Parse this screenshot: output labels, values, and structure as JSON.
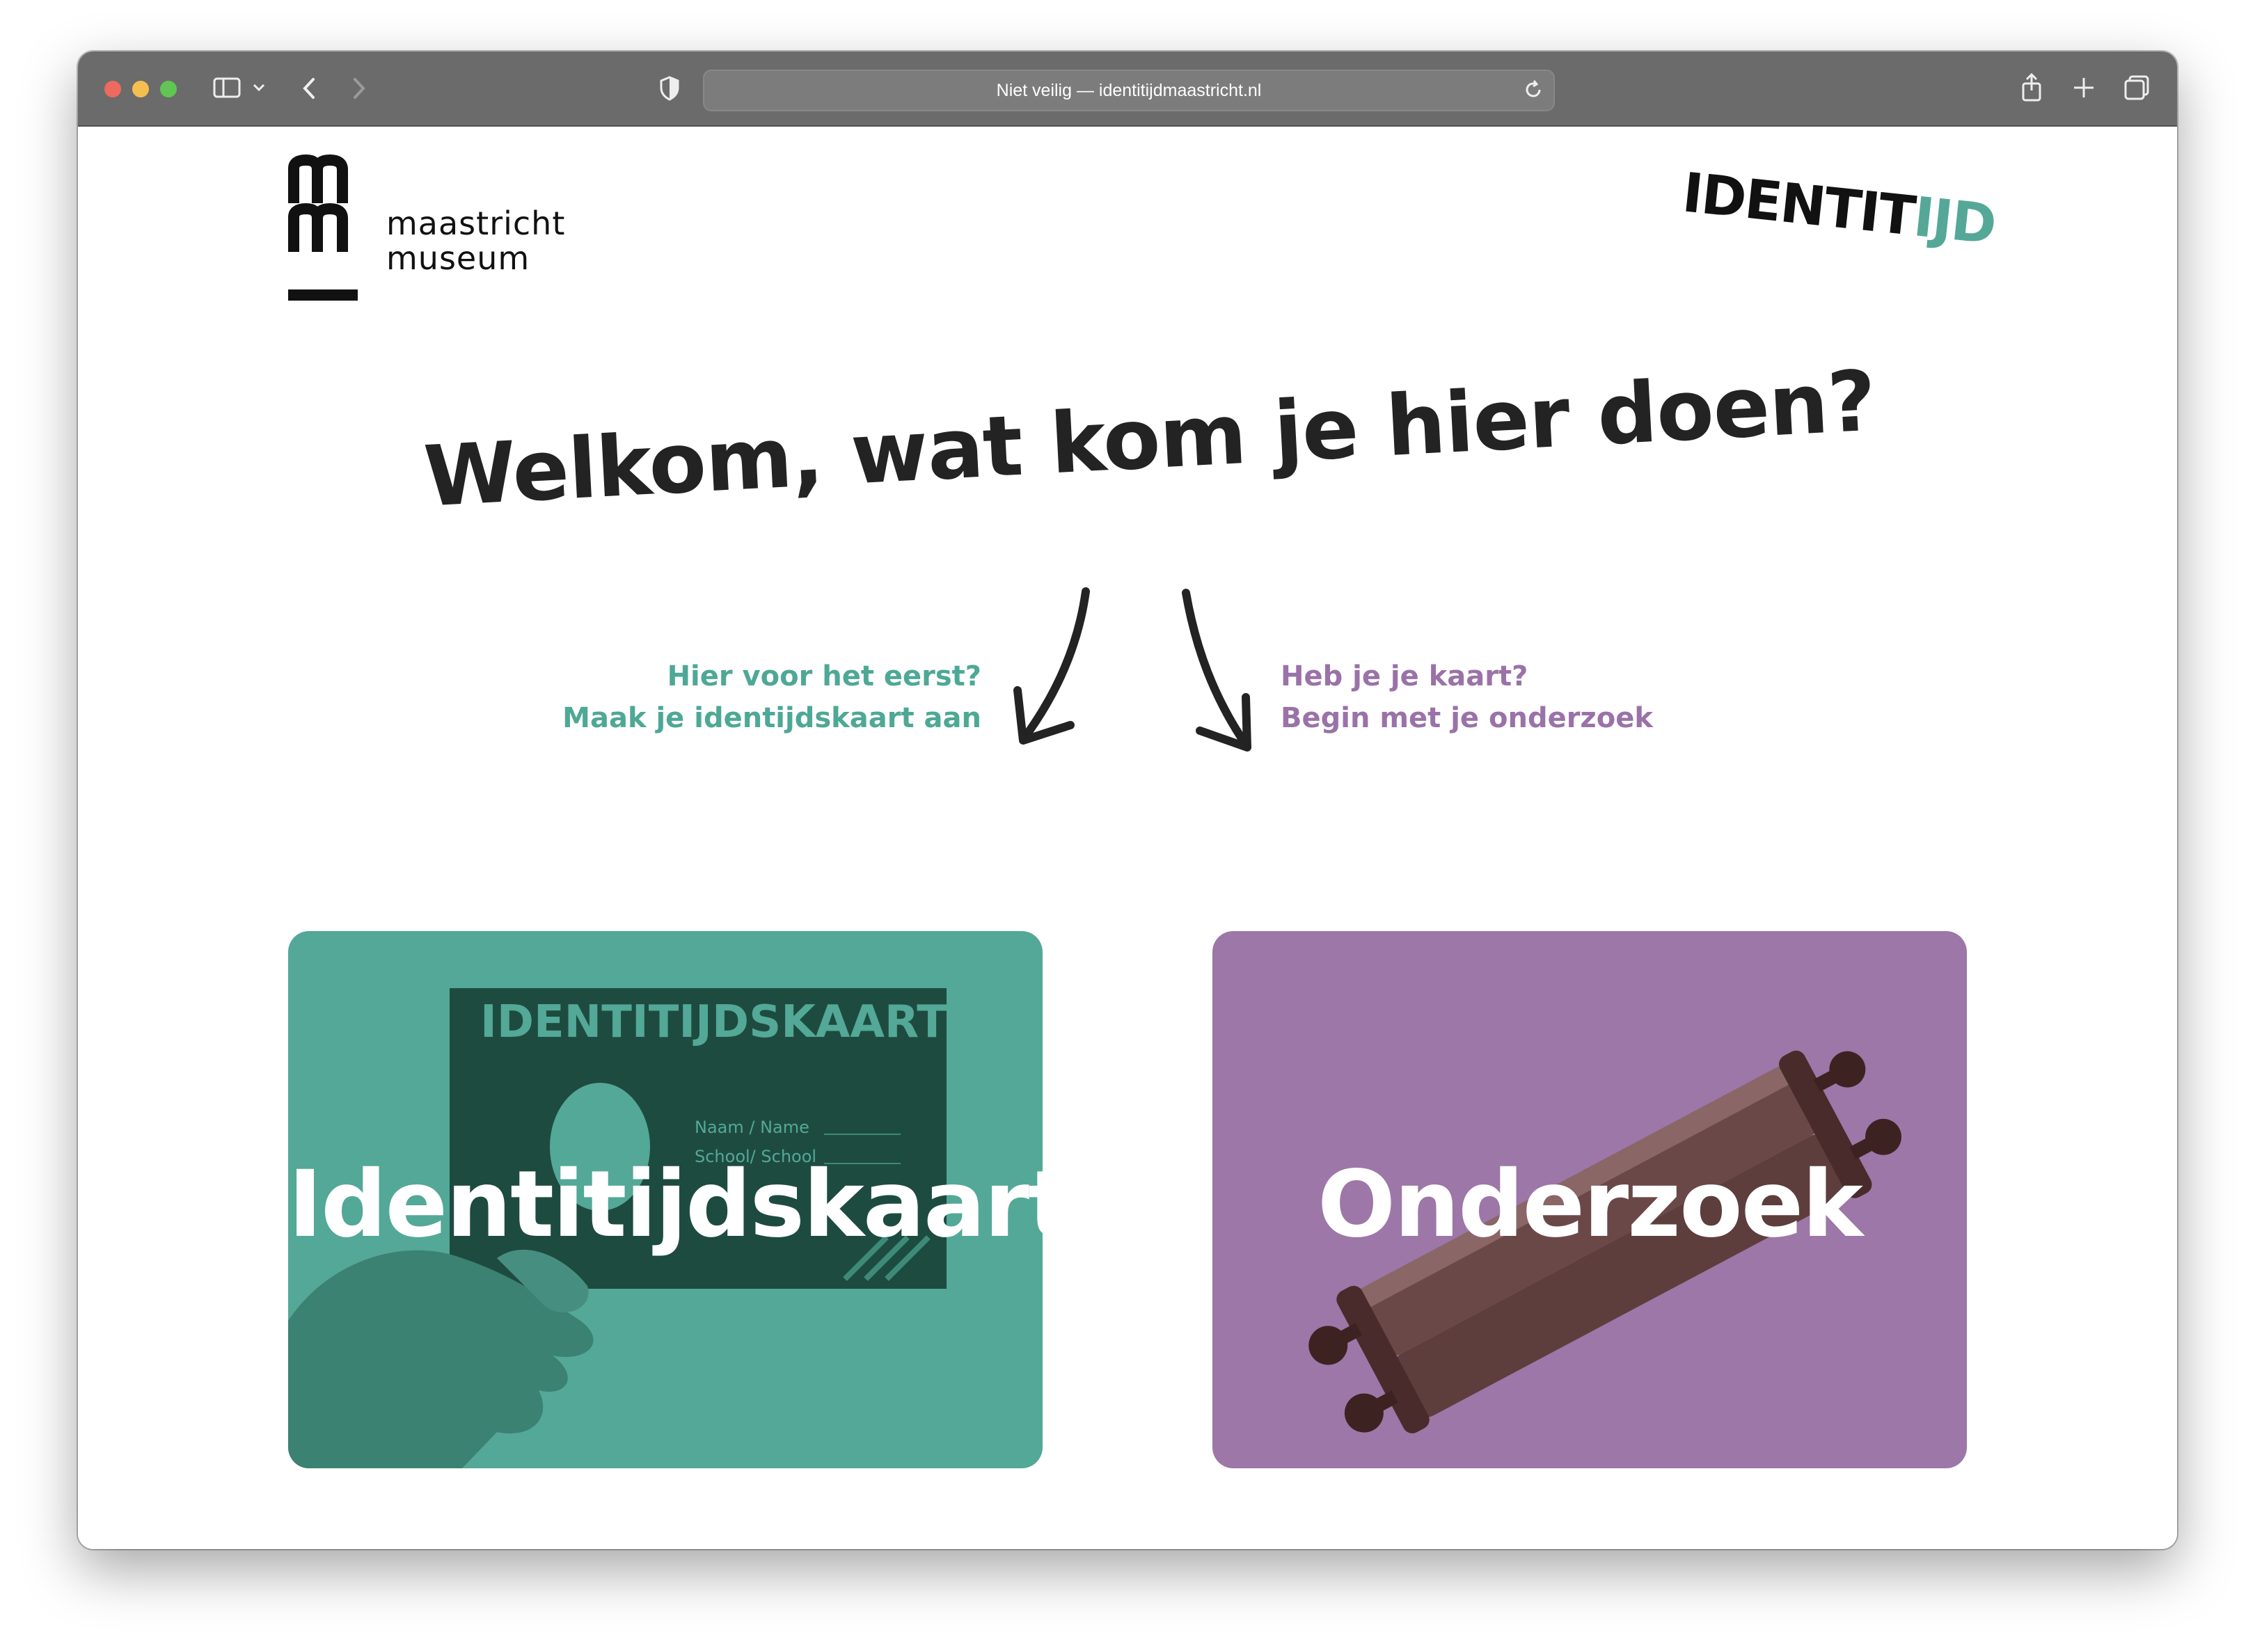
{
  "browser": {
    "address_bar": "Niet veilig — identitijdmaastricht.nl"
  },
  "header": {
    "museum_logo_line1": "maastricht",
    "museum_logo_line2": "museum",
    "identitijd_logo_part1": "IDENTIT",
    "identitijd_logo_part2": "IJD"
  },
  "main": {
    "headline": "Welkom, wat kom je hier doen?",
    "hint_left_line1": "Hier voor het eerst?",
    "hint_left_line2": "Maak je identijdskaart aan",
    "hint_right_line1": "Heb je je kaart?",
    "hint_right_line2": "Begin met je onderzoek"
  },
  "cards": {
    "left": {
      "label": "Identitijdskaart",
      "card_title": "IDENTITIJDSKAART",
      "field1": "Naam / Name",
      "field2": "School/ School"
    },
    "right": {
      "label": "Onderzoek"
    }
  },
  "colors": {
    "teal": "#53a897",
    "purple": "#9c77a7",
    "dark_teal": "#1e4b40"
  }
}
